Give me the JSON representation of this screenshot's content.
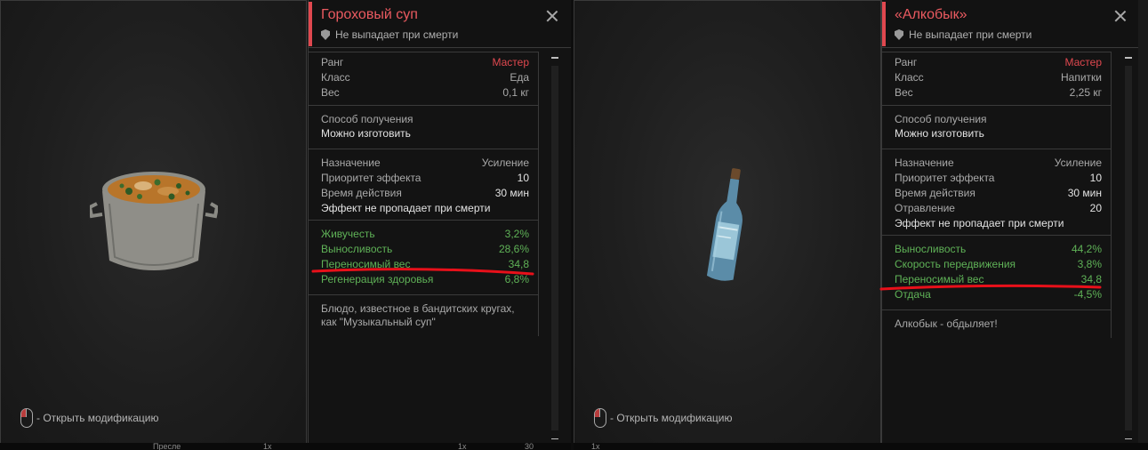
{
  "cards": [
    {
      "title": "Гороховый суп",
      "death_flag": "Не выпадает при смерти",
      "mod_hint": "- Открыть модификацию",
      "basic": [
        {
          "label": "Ранг",
          "value": "Мастер"
        },
        {
          "label": "Класс",
          "value": "Еда"
        },
        {
          "label": "Вес",
          "value": "0,1 кг"
        }
      ],
      "obtain_label": "Способ получения",
      "obtain_value": "Можно изготовить",
      "effects": [
        {
          "label": "Назначение",
          "value": "Усиление"
        },
        {
          "label": "Приоритет эффекта",
          "value": "10"
        },
        {
          "label": "Время действия",
          "value": "30 мин"
        }
      ],
      "effect_note": "Эффект не пропадает при смерти",
      "stats": [
        {
          "label": "Живучесть",
          "value": "3,2%"
        },
        {
          "label": "Выносливость",
          "value": "28,6%"
        },
        {
          "label": "Переносимый вес",
          "value": "34,8"
        },
        {
          "label": "Регенерация здоровья",
          "value": "6,8%"
        }
      ],
      "description": "Блюдо, известное в бандитских кругах, как \"Музыкальный суп\""
    },
    {
      "title": "«Алкобык»",
      "death_flag": "Не выпадает при смерти",
      "mod_hint": "- Открыть модификацию",
      "basic": [
        {
          "label": "Ранг",
          "value": "Мастер"
        },
        {
          "label": "Класс",
          "value": "Напитки"
        },
        {
          "label": "Вес",
          "value": "2,25 кг"
        }
      ],
      "obtain_label": "Способ получения",
      "obtain_value": "Можно изготовить",
      "effects": [
        {
          "label": "Назначение",
          "value": "Усиление"
        },
        {
          "label": "Приоритет эффекта",
          "value": "10"
        },
        {
          "label": "Время действия",
          "value": "30 мин"
        },
        {
          "label": "Отравление",
          "value": "20"
        }
      ],
      "effect_note": "Эффект не пропадает при смерти",
      "stats": [
        {
          "label": "Выносливость",
          "value": "44,2%"
        },
        {
          "label": "Скорость передвижения",
          "value": "3,8%"
        },
        {
          "label": "Переносимый вес",
          "value": "34,8"
        },
        {
          "label": "Отдача",
          "value": "-4,5%"
        }
      ],
      "description": "Алкобык - обдыляет!"
    }
  ],
  "background_fragments": [
    "Пресле",
    "1х",
    "1х",
    "30",
    "1х"
  ],
  "colors": {
    "accent_red": "#e0484f",
    "stat_green": "#5fb257",
    "annotation_red": "#e8101a"
  },
  "icons": [
    "close-icon",
    "shield-icon",
    "mouse-icon",
    "pea-soup-pot-icon",
    "vodka-bottle-icon"
  ]
}
